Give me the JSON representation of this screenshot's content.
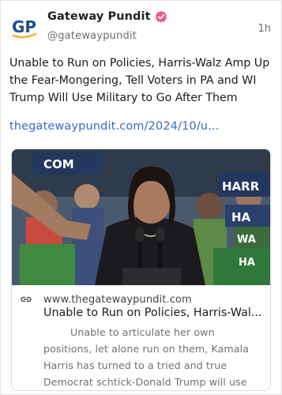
{
  "post": {
    "author_name": "Gateway Pundit",
    "author_handle": "@gatewaypundit",
    "avatar_text": "GP",
    "time": "1h",
    "text": "Unable to Run on Policies, Harris-Walz Amp Up the Fear-Mongering, Tell Voters in PA and WI Trump Will Use Military to Go After Them",
    "link_text": "thegatewaypundit.com/2024/10/u..."
  },
  "card": {
    "domain": "www.thegatewaypundit.com",
    "title": "Unable to Run on Policies, Harris-Wal...",
    "description": "Unable to articulate her own positions, let alone run on them, Kamala Harris has turned to a tried and true Democrat schtick-Donald Trump will use the military a...",
    "image_signs": {
      "left_top": "COM",
      "right_top": "HARR",
      "right_mid": "HA",
      "right_low": "WA",
      "right_bottom": "HA"
    }
  },
  "colors": {
    "brand_blue": "#1f4e8f",
    "brand_gold": "#f2b132",
    "verified": "#e95d8f",
    "link": "#3768cf",
    "muted_text": "#6f6f6f"
  },
  "icons": [
    "verified-badge-icon",
    "link-icon"
  ]
}
